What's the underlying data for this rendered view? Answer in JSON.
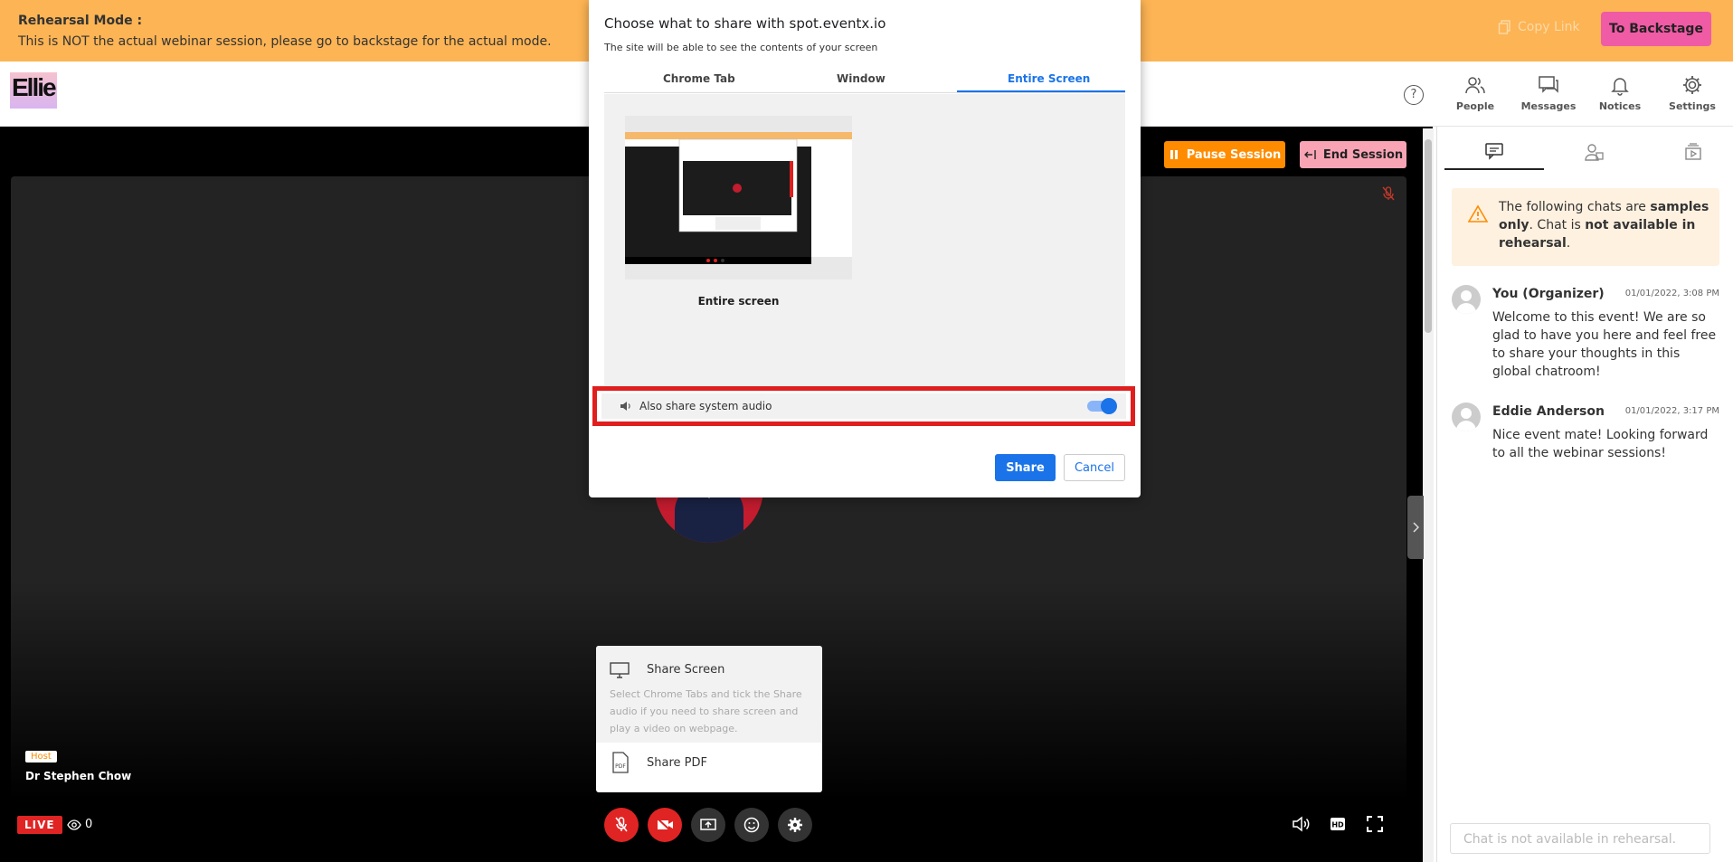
{
  "banner": {
    "title": "Rehearsal Mode :",
    "message": "This is NOT the actual webinar session, please go to backstage for the actual mode.",
    "copy_link": "Copy Link",
    "to_backstage": "To Backstage"
  },
  "logo": {
    "text": "Ellie"
  },
  "nav": {
    "help": "?",
    "items": [
      {
        "label": "People",
        "icon": "people-icon"
      },
      {
        "label": "Messages",
        "icon": "messages-icon"
      },
      {
        "label": "Notices",
        "icon": "bell-icon"
      },
      {
        "label": "Settings",
        "icon": "gear-icon"
      }
    ]
  },
  "session": {
    "pause_label": "Pause Session",
    "end_label": "End Session",
    "host_badge": "Host",
    "host_name": "Dr Stephen Chow",
    "live": "LIVE",
    "viewers": "0"
  },
  "share_menu": {
    "screen_title": "Share Screen",
    "screen_desc": "Select Chrome Tabs and tick the Share audio if you need to share screen and play a video on webpage.",
    "pdf_title": "Share PDF"
  },
  "dialog": {
    "title": "Choose what to share with spot.eventx.io",
    "subtitle": "The site will be able to see the contents of your screen",
    "tabs": [
      "Chrome Tab",
      "Window",
      "Entire Screen"
    ],
    "thumb_label": "Entire screen",
    "audio_label": "Also share system audio",
    "share": "Share",
    "cancel": "Cancel"
  },
  "side_panel": {
    "note_prefix": "The following chats are ",
    "note_bold1": "samples only",
    "note_mid": ". Chat is ",
    "note_bold2": "not available in rehearsal",
    "note_end": ".",
    "messages": [
      {
        "name": "You (Organizer)",
        "time": "01/01/2022, 3:08 PM",
        "text": "Welcome to this event! We are so glad to have you here and feel free to share your thoughts in this global chatroom!"
      },
      {
        "name": "Eddie Anderson",
        "time": "01/01/2022, 3:17 PM",
        "text": "Nice event mate! Looking forward to all the webinar sessions!"
      }
    ],
    "input_placeholder": "Chat is not available in rehearsal."
  },
  "colors": {
    "banner": "#fdb454",
    "backstage": "#f05ba6",
    "pause": "#ff8c00",
    "end": "#f9a4b5",
    "live": "#e02424",
    "chrome_blue": "#1a73e8",
    "highlight": "#e01e1e"
  }
}
